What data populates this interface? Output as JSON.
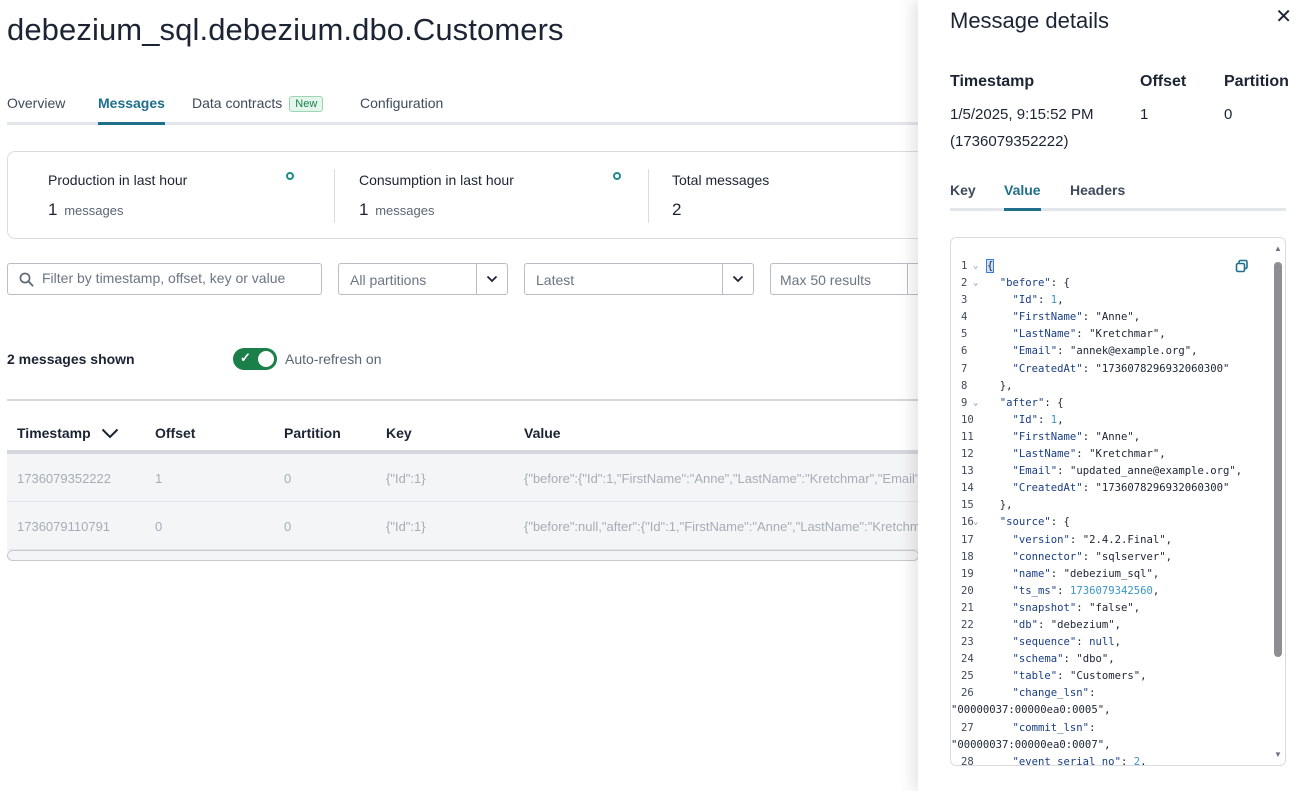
{
  "page": {
    "title": "debezium_sql.debezium.dbo.Customers"
  },
  "tabs": [
    {
      "label": "Overview"
    },
    {
      "label": "Messages"
    },
    {
      "label": "Data contracts",
      "badge": "New"
    },
    {
      "label": "Configuration"
    }
  ],
  "stats": {
    "production": {
      "label": "Production in last hour",
      "value": "1",
      "unit": "messages"
    },
    "consumption": {
      "label": "Consumption in last hour",
      "value": "1",
      "unit": "messages"
    },
    "total": {
      "label": "Total messages",
      "value": "2"
    }
  },
  "filters": {
    "search_placeholder": "Filter by timestamp, offset, key or value",
    "partitions": "All partitions",
    "start": "Latest",
    "max_results": "Max 50 results"
  },
  "list": {
    "shown_label": "2 messages shown",
    "auto_refresh_label": "Auto-refresh on",
    "auto_refresh_on": true
  },
  "table": {
    "headers": {
      "timestamp": "Timestamp",
      "offset": "Offset",
      "partition": "Partition",
      "key": "Key",
      "value": "Value"
    },
    "rows": [
      {
        "timestamp": "1736079352222",
        "offset": "1",
        "partition": "0",
        "key": "{\"Id\":1}",
        "value": "{\"before\":{\"Id\":1,\"FirstName\":\"Anne\",\"LastName\":\"Kretchmar\",\"Email\":\""
      },
      {
        "timestamp": "1736079110791",
        "offset": "0",
        "partition": "0",
        "key": "{\"Id\":1}",
        "value": "{\"before\":null,\"after\":{\"Id\":1,\"FirstName\":\"Anne\",\"LastName\":\"Kretchma"
      }
    ]
  },
  "drawer": {
    "title": "Message details",
    "close": "✕",
    "timestamp_label": "Timestamp",
    "timestamp_value": "1/5/2025, 9:15:52 PM",
    "timestamp_raw": "(1736079352222)",
    "offset_label": "Offset",
    "offset_value": "1",
    "partition_label": "Partition",
    "partition_value": "0",
    "tabs": {
      "key": "Key",
      "value": "Value",
      "headers": "Headers"
    },
    "active_tab": "Value"
  },
  "code_lines": [
    {
      "n": "1",
      "fold": true,
      "html": "{"
    },
    {
      "n": "2",
      "fold": true,
      "html": "  <span class='k'>\"before\"</span>: {"
    },
    {
      "n": "3",
      "html": "    <span class='k'>\"Id\"</span>: <span class='n'>1</span>,"
    },
    {
      "n": "4",
      "html": "    <span class='k'>\"FirstName\"</span>: <span class='s'>\"Anne\"</span>,"
    },
    {
      "n": "5",
      "html": "    <span class='k'>\"LastName\"</span>: <span class='s'>\"Kretchmar\"</span>,"
    },
    {
      "n": "6",
      "html": "    <span class='k'>\"Email\"</span>: <span class='s'>\"annek@example.org\"</span>,"
    },
    {
      "n": "7",
      "html": "    <span class='k'>\"CreatedAt\"</span>: <span class='s'>\"1736078296932060300\"</span>"
    },
    {
      "n": "8",
      "html": "  },"
    },
    {
      "n": "9",
      "fold": true,
      "html": "  <span class='k'>\"after\"</span>: {"
    },
    {
      "n": "10",
      "html": "    <span class='k'>\"Id\"</span>: <span class='n'>1</span>,"
    },
    {
      "n": "11",
      "html": "    <span class='k'>\"FirstName\"</span>: <span class='s'>\"Anne\"</span>,"
    },
    {
      "n": "12",
      "html": "    <span class='k'>\"LastName\"</span>: <span class='s'>\"Kretchmar\"</span>,"
    },
    {
      "n": "13",
      "html": "    <span class='k'>\"Email\"</span>: <span class='s'>\"updated_anne@example.org\"</span>,"
    },
    {
      "n": "14",
      "html": "    <span class='k'>\"CreatedAt\"</span>: <span class='s'>\"1736078296932060300\"</span>"
    },
    {
      "n": "15",
      "html": "  },"
    },
    {
      "n": "16",
      "fold": true,
      "html": "  <span class='k'>\"source\"</span>: {"
    },
    {
      "n": "17",
      "html": "    <span class='k'>\"version\"</span>: <span class='s'>\"2.4.2.Final\"</span>,"
    },
    {
      "n": "18",
      "html": "    <span class='k'>\"connector\"</span>: <span class='s'>\"sqlserver\"</span>,"
    },
    {
      "n": "19",
      "html": "    <span class='k'>\"name\"</span>: <span class='s'>\"debezium_sql\"</span>,"
    },
    {
      "n": "20",
      "html": "    <span class='k'>\"ts_ms\"</span>: <span class='n'>1736079342560</span>,"
    },
    {
      "n": "21",
      "html": "    <span class='k'>\"snapshot\"</span>: <span class='s'>\"false\"</span>,"
    },
    {
      "n": "22",
      "html": "    <span class='k'>\"db\"</span>: <span class='s'>\"debezium\"</span>,"
    },
    {
      "n": "23",
      "html": "    <span class='k'>\"sequence\"</span>: <span class='k'>null</span>,"
    },
    {
      "n": "24",
      "html": "    <span class='k'>\"schema\"</span>: <span class='s'>\"dbo\"</span>,"
    },
    {
      "n": "25",
      "html": "    <span class='k'>\"table\"</span>: <span class='s'>\"Customers\"</span>,"
    },
    {
      "n": "26",
      "html": "    <span class='k'>\"change_lsn\"</span>:"
    },
    {
      "n": "",
      "wrap": true,
      "html": "<span class='s'>\"00000037:00000ea0:0005\"</span>,"
    },
    {
      "n": "27",
      "html": "    <span class='k'>\"commit_lsn\"</span>:"
    },
    {
      "n": "",
      "wrap": true,
      "html": "<span class='s'>\"00000037:00000ea0:0007\"</span>,"
    },
    {
      "n": "28",
      "html": "    <span class='k'>\"event_serial_no\"</span>: <span class='n'>2</span>,"
    }
  ]
}
